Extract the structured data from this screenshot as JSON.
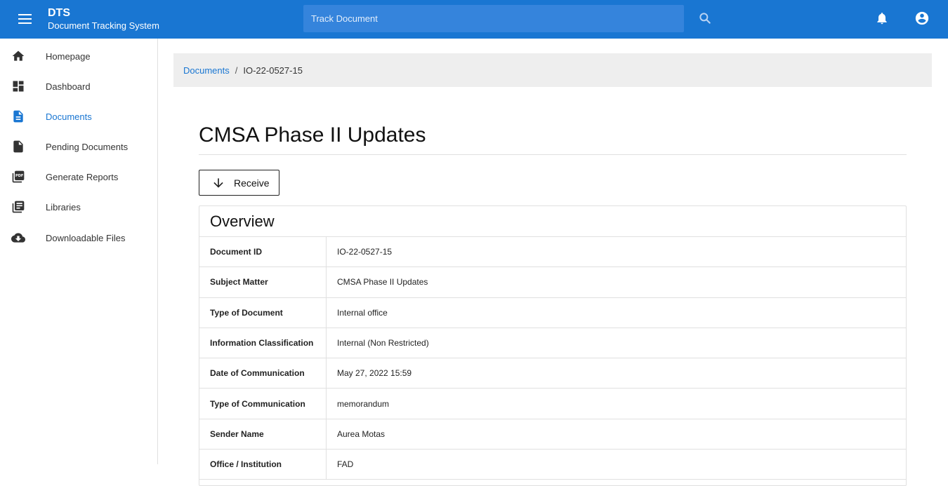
{
  "app": {
    "title": "DTS",
    "subtitle": "Document Tracking System"
  },
  "search": {
    "placeholder": "Track Document",
    "value": ""
  },
  "icons": {
    "menu": "menu-icon",
    "search": "search-icon",
    "notifications": "bell-icon",
    "account": "account-circle-icon",
    "receive": "arrow-down-icon"
  },
  "colors": {
    "primary": "#1976d2",
    "search_bg": "#3584dc",
    "breadcrumb_bg": "#eeeeee",
    "border": "#e0e0e0"
  },
  "sidebar": {
    "items": [
      {
        "label": "Homepage",
        "icon": "home-icon",
        "active": false
      },
      {
        "label": "Dashboard",
        "icon": "dashboard-icon",
        "active": false
      },
      {
        "label": "Documents",
        "icon": "document-icon",
        "active": true
      },
      {
        "label": "Pending Documents",
        "icon": "file-icon",
        "active": false
      },
      {
        "label": "Generate Reports",
        "icon": "pdf-icon",
        "active": false
      },
      {
        "label": "Libraries",
        "icon": "library-icon",
        "active": false
      },
      {
        "label": "Downloadable Files",
        "icon": "cloud-download-icon",
        "active": false
      }
    ]
  },
  "breadcrumb": {
    "link": "Documents",
    "separator": "/",
    "current": "IO-22-0527-15"
  },
  "page": {
    "title": "CMSA Phase II Updates",
    "receive_label": "Receive"
  },
  "overview": {
    "heading": "Overview",
    "rows": [
      {
        "key": "Document ID",
        "value": "IO-22-0527-15"
      },
      {
        "key": "Subject Matter",
        "value": "CMSA Phase II Updates"
      },
      {
        "key": "Type of Document",
        "value": "Internal office"
      },
      {
        "key": "Information Classification",
        "value": "Internal (Non Restricted)"
      },
      {
        "key": "Date of Communication",
        "value": "May 27, 2022 15:59"
      },
      {
        "key": "Type of Communication",
        "value": "memorandum"
      },
      {
        "key": "Sender Name",
        "value": "Aurea Motas"
      },
      {
        "key": "Office / Institution",
        "value": "FAD"
      }
    ]
  }
}
